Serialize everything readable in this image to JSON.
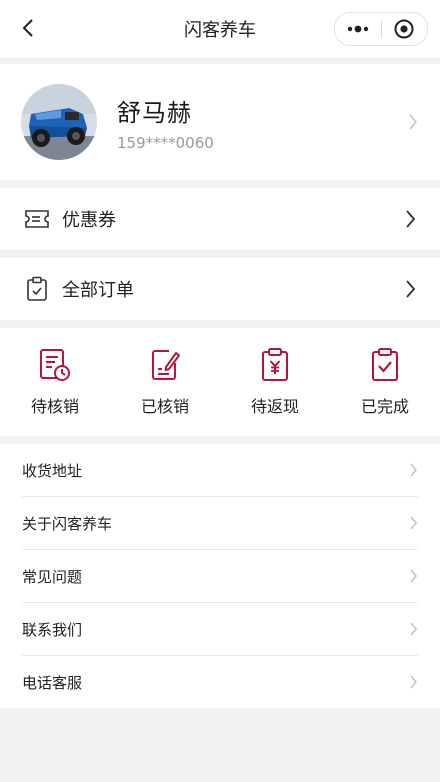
{
  "nav": {
    "title": "闪客养车",
    "back_icon": "chevron-left-icon",
    "more_icon": "more-dots-icon",
    "close_icon": "target-circle-icon"
  },
  "profile": {
    "name": "舒马赫",
    "phone": "159****0060",
    "avatar": "blue-jeep-photo"
  },
  "coupon": {
    "label": "优惠券",
    "icon": "ticket-icon"
  },
  "all_orders": {
    "label": "全部订单",
    "icon": "clipboard-check-icon"
  },
  "order_status": [
    {
      "label": "待核销",
      "icon": "document-clock-icon"
    },
    {
      "label": "已核销",
      "icon": "document-edit-icon"
    },
    {
      "label": "待返现",
      "icon": "clipboard-yen-icon"
    },
    {
      "label": "已完成",
      "icon": "clipboard-check-icon"
    }
  ],
  "menu": [
    {
      "label": "收货地址"
    },
    {
      "label": "关于闪客养车"
    },
    {
      "label": "常见问题"
    },
    {
      "label": "联系我们"
    },
    {
      "label": "电话客服"
    }
  ],
  "colors": {
    "accent": "#b3173c",
    "background": "#f2f2f2",
    "text": "#222222",
    "muted": "#999999"
  }
}
